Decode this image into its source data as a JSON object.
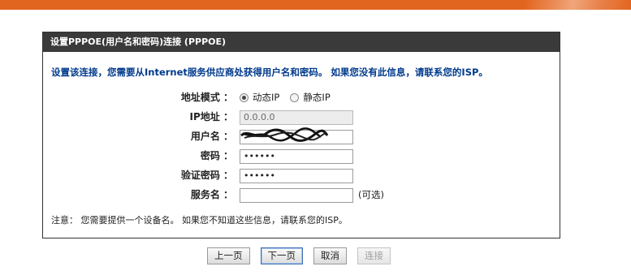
{
  "panel": {
    "title": "设置PPPOE(用户名和密码)连接 (PPPOE)",
    "intro": "设置该连接，您需要从Internet服务供应商处获得用户名和密码。 如果您没有此信息，请联系您的ISP。"
  },
  "form": {
    "address_mode": {
      "label": "地址模式 ：",
      "options": [
        {
          "label": "动态IP",
          "checked": true
        },
        {
          "label": "静态IP",
          "checked": false
        }
      ]
    },
    "ip_address": {
      "label": "IP地址 ：",
      "value": "0.0.0.0"
    },
    "username": {
      "label": "用户名 ：",
      "value": ""
    },
    "password": {
      "label": "密码 ：",
      "value": "••••••"
    },
    "verify_password": {
      "label": "验证密码 ：",
      "value": "••••••"
    },
    "service_name": {
      "label": "服务名 ：",
      "value": "",
      "optional_hint": "(可选)"
    }
  },
  "note": "注意： 您需要提供一个设备名。 如果您不知道这些信息，请联系您的ISP。",
  "buttons": {
    "prev": "上一页",
    "next": "下一页",
    "cancel": "取消",
    "connect": "连接"
  },
  "colors": {
    "top_band": "#e2651f",
    "header_bg": "#3a3a3a",
    "intro_text": "#003a8c"
  }
}
